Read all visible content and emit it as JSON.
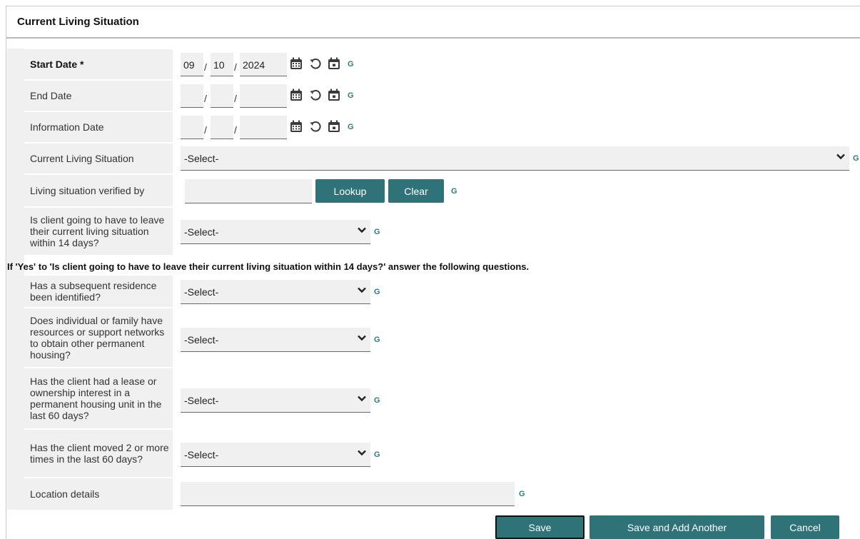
{
  "panel": {
    "title": "Current Living Situation"
  },
  "fields": {
    "start_date": {
      "label": "Start Date *",
      "month": "09",
      "day": "10",
      "year": "2024"
    },
    "end_date": {
      "label": "End Date",
      "month": "",
      "day": "",
      "year": ""
    },
    "information_date": {
      "label": "Information Date",
      "month": "",
      "day": "",
      "year": ""
    },
    "current_living_situation": {
      "label": "Current Living Situation",
      "value": "-Select-"
    },
    "verified_by": {
      "label": "Living situation verified by",
      "value": "",
      "lookup": "Lookup",
      "clear": "Clear"
    },
    "leave_14_days": {
      "label": "Is client going to have to leave their current living situation within 14 days?",
      "value": "-Select-"
    },
    "note": "If 'Yes' to 'Is client going to have to leave their current living situation within 14 days?' answer the following questions.",
    "subsequent_residence": {
      "label": "Has a subsequent residence been identified?",
      "value": "-Select-"
    },
    "resources_support": {
      "label": "Does individual or family have resources or support networks to obtain other permanent housing?",
      "value": "-Select-"
    },
    "lease_ownership": {
      "label": "Has the client had a lease or ownership interest in a permanent housing unit in the last 60 days?",
      "value": "-Select-"
    },
    "moved_times": {
      "label": "Has the client moved 2 or more times in the last 60 days?",
      "value": "-Select-"
    },
    "location_details": {
      "label": "Location details",
      "value": ""
    }
  },
  "g_label": "G",
  "actions": {
    "save": "Save",
    "save_add": "Save and Add Another",
    "cancel": "Cancel"
  },
  "icons": [
    "calendar-icon",
    "reset-icon",
    "today-icon",
    "chevron-down-icon"
  ],
  "colors": {
    "button": "#2f7378",
    "g_link": "#2e7b80",
    "field_bg": "#f0f0f0"
  }
}
